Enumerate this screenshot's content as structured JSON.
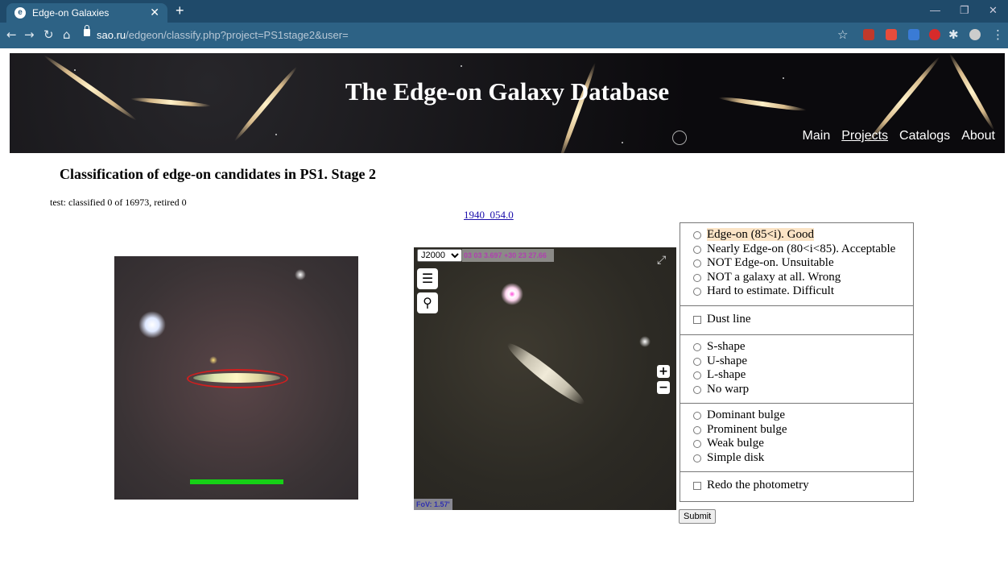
{
  "browser": {
    "tab_title": "Edge-on Galaxies",
    "url_host": "sao.ru",
    "url_path": "/edgeon/classify.php?project=PS1stage2&user="
  },
  "banner": {
    "title": "The Edge-on Galaxy Database",
    "nav": [
      "Main",
      "Projects",
      "Catalogs",
      "About"
    ]
  },
  "page": {
    "heading": "Classification of edge-on candidates in PS1. Stage 2",
    "status": "test: classified 0 of 16973, retired 0",
    "object_link": "1940_054.0"
  },
  "viewer": {
    "frame_options": [
      "J2000"
    ],
    "selected_frame": "J2000",
    "coords": "03 03 3.697 +30 23 27.66",
    "fov": "FoV: 1.57'"
  },
  "form": {
    "inclination": [
      "Edge-on (85<i). Good",
      "Nearly Edge-on (80<i<85). Acceptable",
      "NOT Edge-on. Unsuitable",
      "NOT a galaxy at all. Wrong",
      "Hard to estimate. Difficult"
    ],
    "dust": "Dust line",
    "warp": [
      "S-shape",
      "U-shape",
      "L-shape",
      "No warp"
    ],
    "bulge": [
      "Dominant bulge",
      "Prominent bulge",
      "Weak bulge",
      "Simple disk"
    ],
    "redo": "Redo the photometry",
    "submit": "Submit"
  }
}
